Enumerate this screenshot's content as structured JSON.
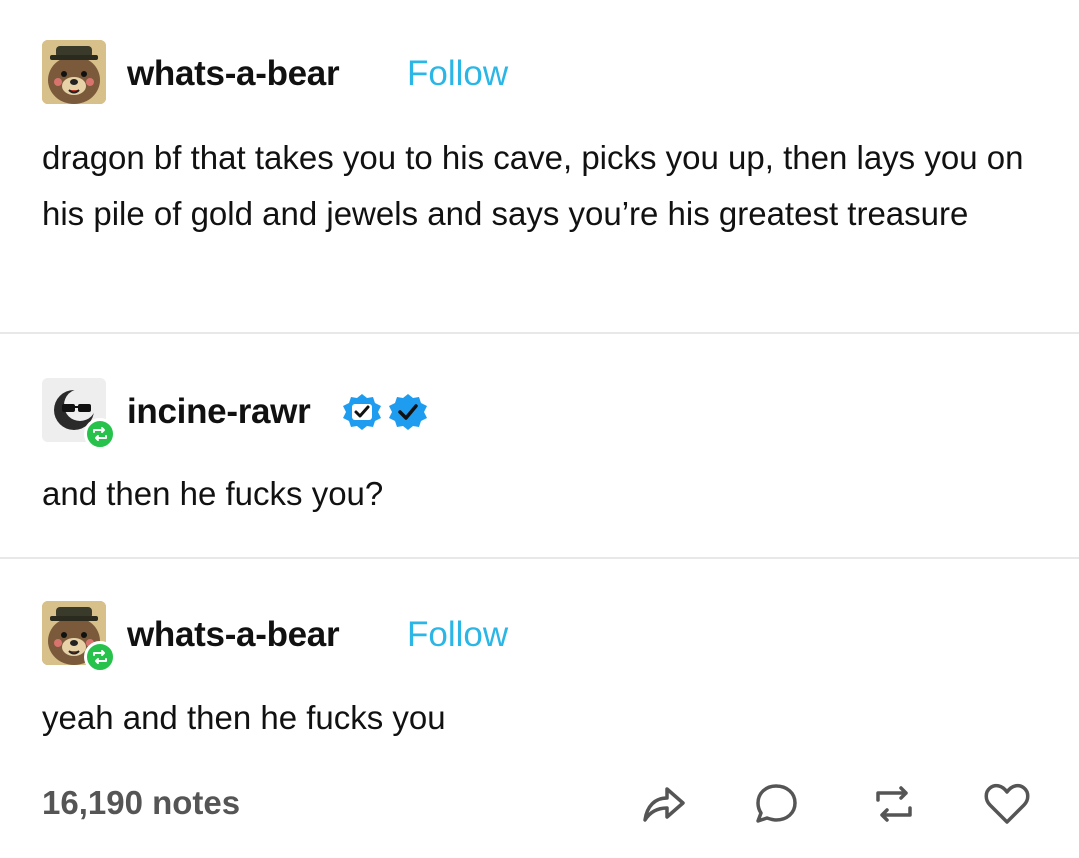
{
  "posts": [
    {
      "username": "whats-a-bear",
      "follow_label": "Follow",
      "text": "dragon bf that takes you to his cave, picks you up, then lays you on his pile of gold and jewels and says you’re his greatest treasure"
    },
    {
      "username": "incine-rawr",
      "text": "and then he fucks you?"
    },
    {
      "username": "whats-a-bear",
      "follow_label": "Follow",
      "text": "yeah and then he fucks you"
    }
  ],
  "footer": {
    "notes": "16,190 notes",
    "actions": [
      "share-icon",
      "comment-icon",
      "reblog-icon",
      "like-icon"
    ]
  },
  "colors": {
    "follow": "#2bb6e6",
    "reblog_badge": "#27c24c",
    "verified_badge": "#1e9cf0",
    "divider": "#e8e8e8"
  }
}
